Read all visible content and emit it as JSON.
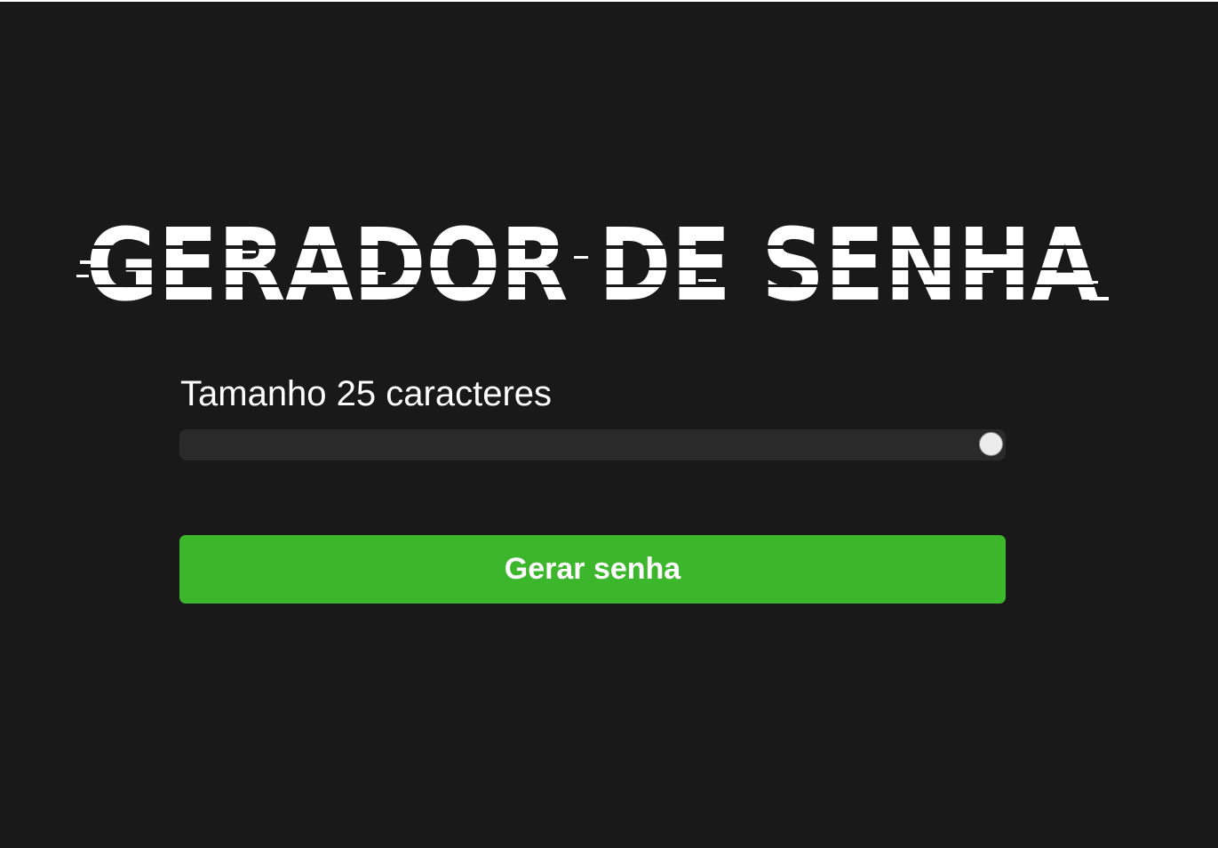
{
  "header": {
    "logo_text": "GERADOR DE SENHA"
  },
  "length": {
    "label": "Tamanho 25 caracteres",
    "value": 25,
    "slider_fraction": 1.0
  },
  "actions": {
    "generate_label": "Gerar senha"
  },
  "colors": {
    "background": "#191919",
    "track": "#2b2a2a",
    "accent_green": "#3cb72c",
    "text": "#ffffff"
  }
}
